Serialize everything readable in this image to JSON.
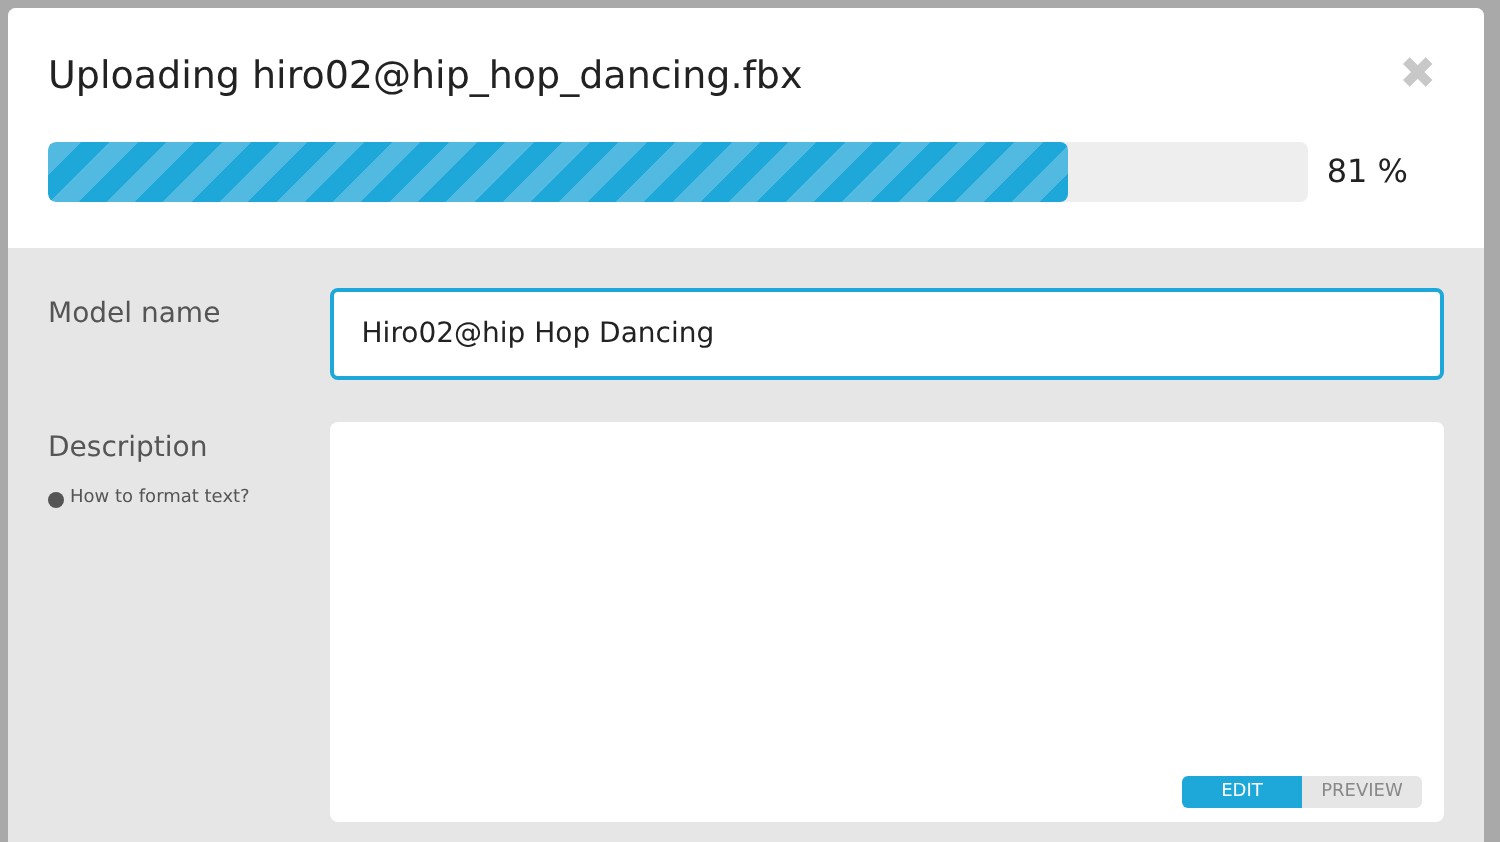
{
  "dialog": {
    "title": "Uploading hiro02@hip_hop_dancing.fbx",
    "close": "✖"
  },
  "progress": {
    "level": 0.81,
    "reading": "81 %"
  },
  "fields": [
    {
      "label": "Model name",
      "kind": "input",
      "value": "Hiro02@hip Hop Dancing"
    },
    {
      "label": "Description",
      "kind": "textarea",
      "help": "How to format text?",
      "tabs": [
        {
          "label": "EDIT",
          "selected": true
        },
        {
          "label": "PREVIEW",
          "selected": false
        }
      ]
    }
  ]
}
